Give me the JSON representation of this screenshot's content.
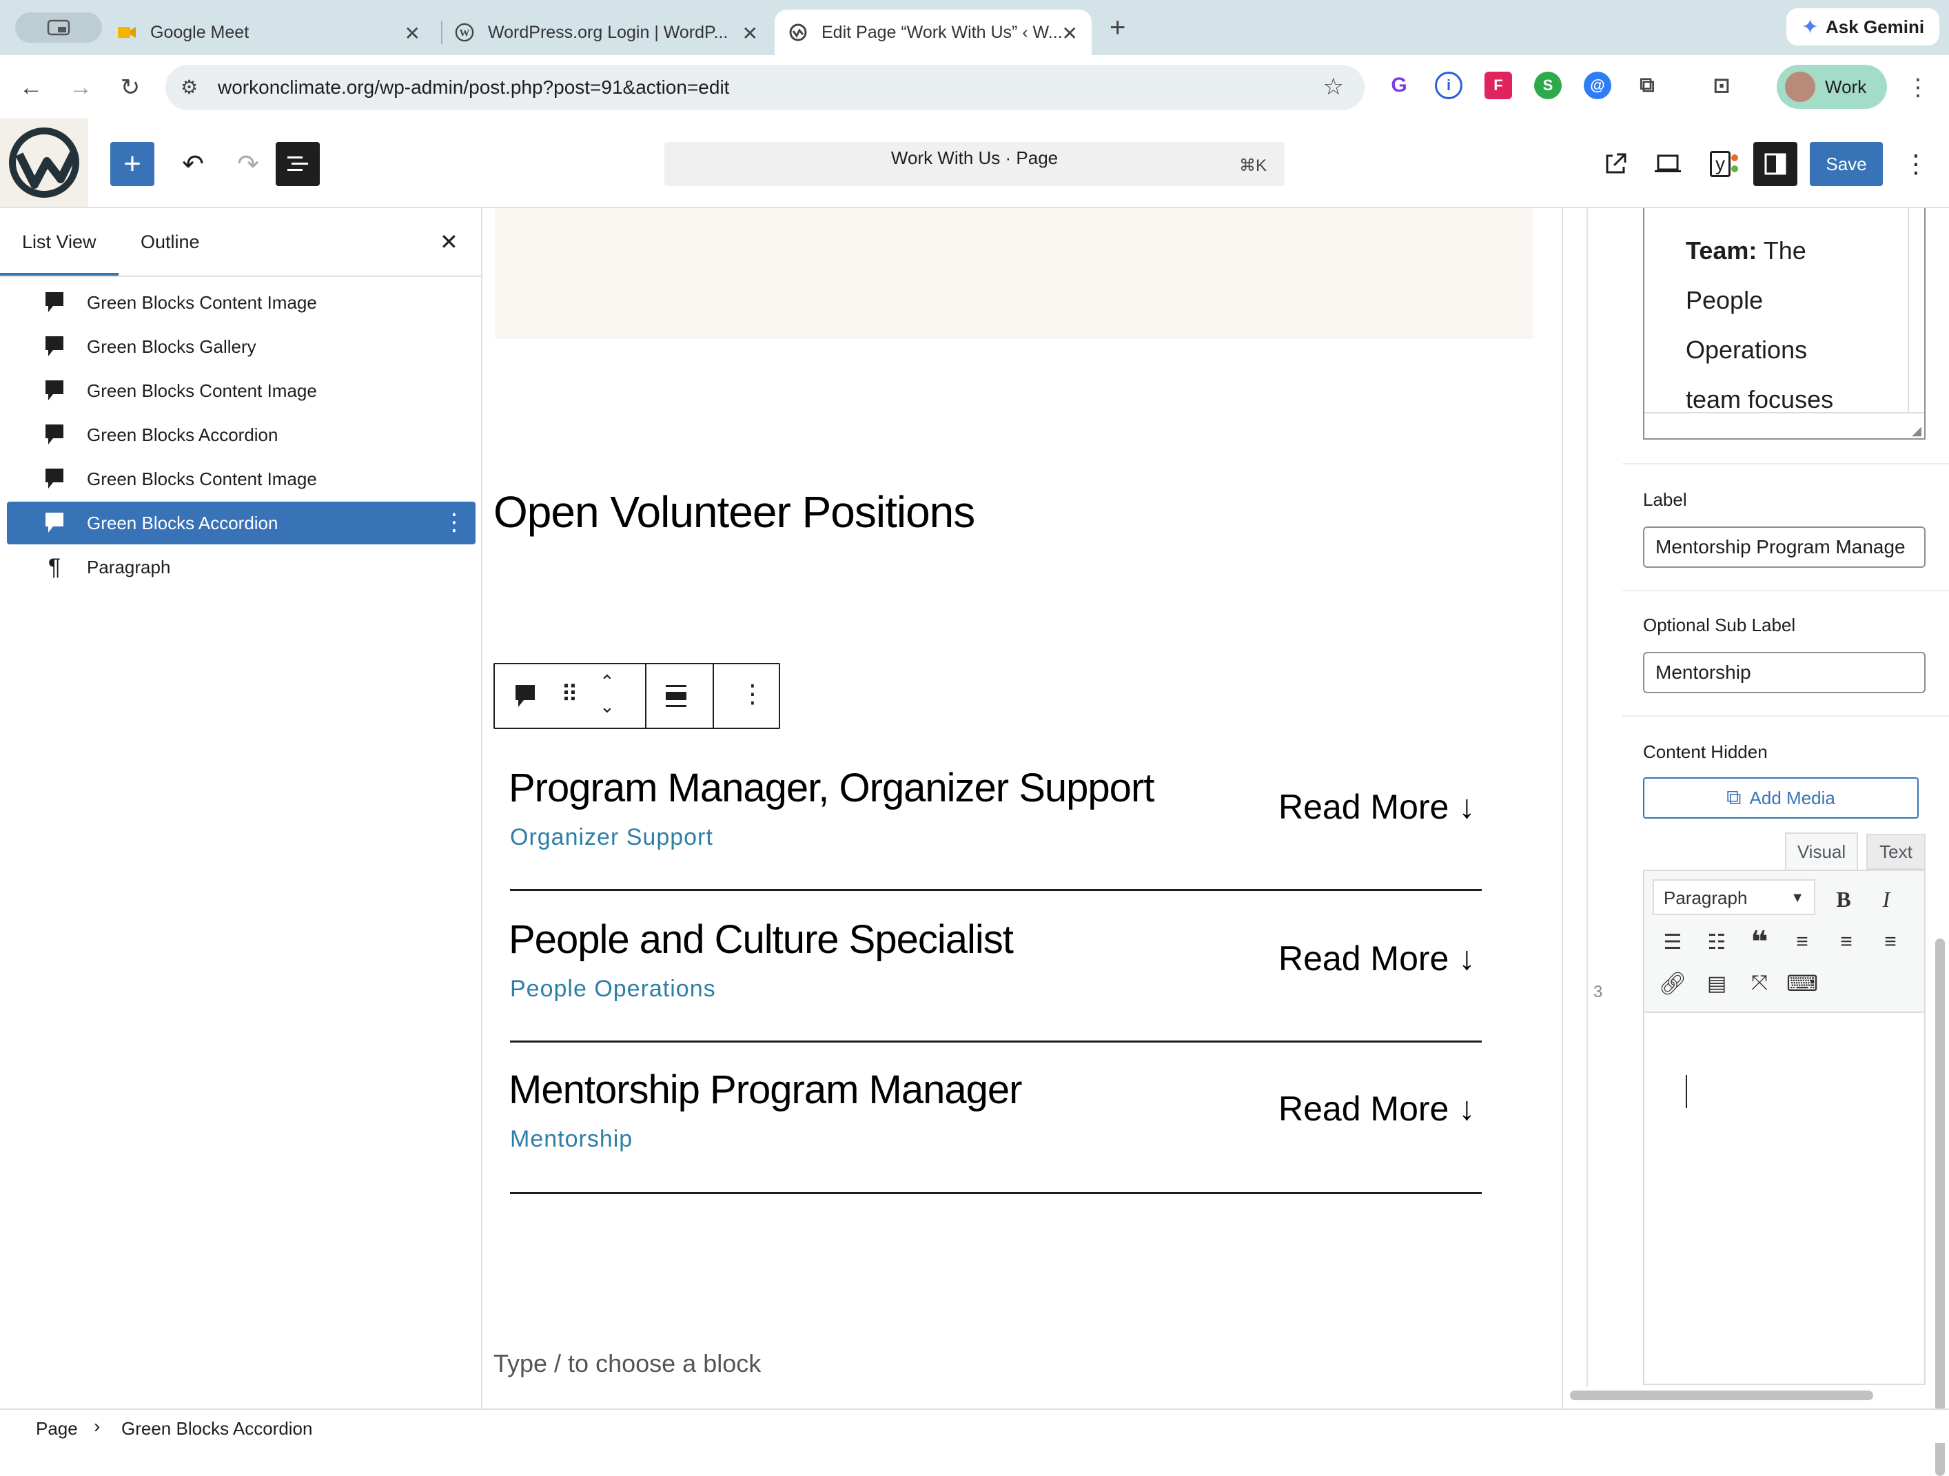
{
  "browser": {
    "tabs": [
      {
        "label": ""
      },
      {
        "label": "Google Meet"
      },
      {
        "label": "WordPress.org Login | WordP..."
      },
      {
        "label": "Edit Page “Work With Us” ‹ W..."
      }
    ],
    "ask_gemini": "Ask Gemini",
    "url": "workonclimate.org/wp-admin/post.php?post=91&action=edit",
    "profile": "Work"
  },
  "editor_header": {
    "command_title": "Work With Us · Page",
    "shortcut": "⌘K",
    "save_label": "Save"
  },
  "list_view": {
    "tabs": [
      "List View",
      "Outline"
    ],
    "items": [
      {
        "label": "Green Blocks Content Image",
        "selected": false,
        "icon": "comment-bubble-icon"
      },
      {
        "label": "Green Blocks Gallery",
        "selected": false,
        "icon": "comment-bubble-icon"
      },
      {
        "label": "Green Blocks Content Image",
        "selected": false,
        "icon": "comment-bubble-icon"
      },
      {
        "label": "Green Blocks Accordion",
        "selected": false,
        "icon": "comment-bubble-icon"
      },
      {
        "label": "Green Blocks Content Image",
        "selected": false,
        "icon": "comment-bubble-icon"
      },
      {
        "label": "Green Blocks Accordion",
        "selected": true,
        "icon": "comment-bubble-icon"
      },
      {
        "label": "Paragraph",
        "selected": false,
        "icon": "pilcrow-icon"
      }
    ]
  },
  "canvas": {
    "heading": "Open Volunteer Positions",
    "accordion": [
      {
        "title": "Program Manager, Organizer Support",
        "sub": "Organizer Support",
        "read": "Read More"
      },
      {
        "title": "People and Culture Specialist",
        "sub": "People Operations",
        "read": "Read More"
      },
      {
        "title": "Mentorship Program Manager",
        "sub": "Mentorship",
        "read": "Read More"
      }
    ],
    "placeholder": "Type / to choose a block"
  },
  "settings": {
    "preview_lines": [
      {
        "bold": "Team:",
        "rest": " The"
      },
      {
        "bold": "",
        "rest": "People"
      },
      {
        "bold": "",
        "rest": "Operations"
      },
      {
        "bold": "",
        "rest": "team focuses"
      }
    ],
    "label_title": "Label",
    "label_value": "Mentorship Program Manage",
    "sublabel_title": "Optional Sub Label",
    "sublabel_value": "Mentorship",
    "content_hidden_title": "Content Hidden",
    "add_media": "Add Media",
    "editor_tabs": [
      "Visual",
      "Text"
    ],
    "format_select": "Paragraph",
    "row_number": "3"
  },
  "breadcrumb": [
    "Page",
    "Green Blocks Accordion"
  ],
  "colors": {
    "accent": "#3873b8",
    "sub_label": "#2e7fa6",
    "cream_block": "#f9f5f0"
  }
}
